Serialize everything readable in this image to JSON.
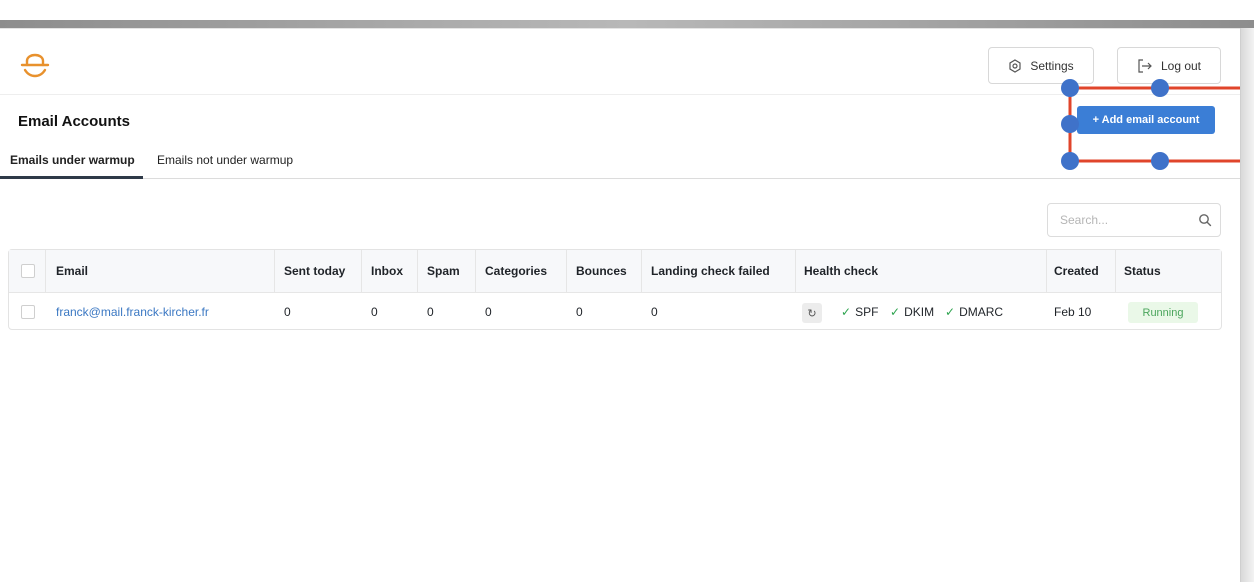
{
  "header": {
    "settings_label": "Settings",
    "logout_label": "Log out"
  },
  "page": {
    "title": "Email Accounts",
    "add_button_label": "+ Add email account"
  },
  "tabs": [
    {
      "label": "Emails under warmup",
      "active": true
    },
    {
      "label": "Emails not under warmup",
      "active": false
    }
  ],
  "search": {
    "placeholder": "Search..."
  },
  "table": {
    "columns": [
      "Email",
      "Sent today",
      "Inbox",
      "Spam",
      "Categories",
      "Bounces",
      "Landing check failed",
      "Health check",
      "Created",
      "Status"
    ],
    "rows": [
      {
        "email": "franck@mail.franck-kircher.fr",
        "sent_today": "0",
        "inbox": "0",
        "spam": "0",
        "categories": "0",
        "bounces": "0",
        "landing_check_failed": "0",
        "health_check": [
          "SPF",
          "DKIM",
          "DMARC"
        ],
        "created": "Feb 10",
        "status": "Running"
      }
    ]
  },
  "colors": {
    "accent": "#3b7ed6",
    "logo": "#e8912d",
    "status_running_bg": "#eaf8e8",
    "status_running_text": "#4aa55c",
    "annotation_line": "#e0452b",
    "annotation_handle": "#3f72c9"
  },
  "icons": [
    "logo-icon",
    "settings-gear-icon",
    "logout-icon",
    "search-icon",
    "refresh-icon",
    "check-icon"
  ]
}
